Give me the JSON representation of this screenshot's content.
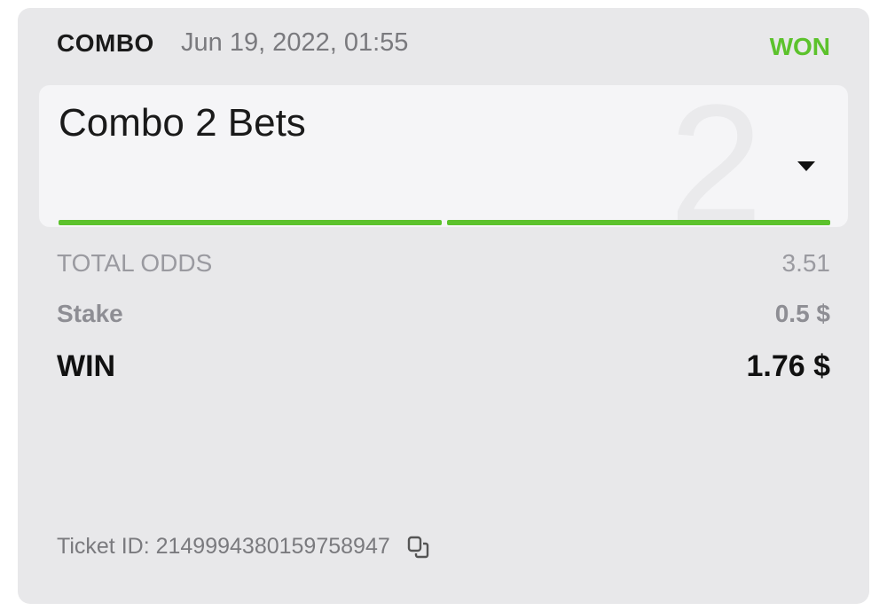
{
  "bet": {
    "type": "COMBO",
    "date": "Jun 19, 2022, 01:55",
    "status": "WON",
    "status_color": "#5cc22c"
  },
  "combo": {
    "title": "Combo 2 Bets",
    "count": "2",
    "dropdown_icon": "caret-down-icon",
    "legs": [
      "won",
      "won"
    ]
  },
  "summary": {
    "total_odds_label": "TOTAL ODDS",
    "total_odds_value": "3.51",
    "stake_label": "Stake",
    "stake_value": "0.5 $",
    "win_label": "WIN",
    "win_value": "1.76 $"
  },
  "ticket": {
    "label": "Ticket ID: 2149994380159758947",
    "copy_icon": "copy-icon"
  }
}
